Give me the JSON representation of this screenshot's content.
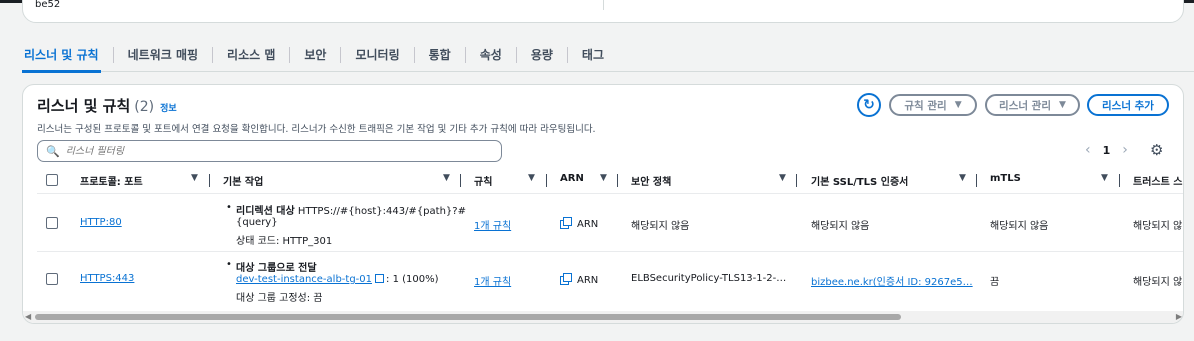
{
  "previous_card": {
    "text": "be52"
  },
  "tabs": [
    {
      "label": "리스너 및 규칙",
      "active": true
    },
    {
      "label": "네트워크 매핑"
    },
    {
      "label": "리소스 맵"
    },
    {
      "label": "보안"
    },
    {
      "label": "모니터링"
    },
    {
      "label": "통합"
    },
    {
      "label": "속성"
    },
    {
      "label": "용량"
    },
    {
      "label": "태그"
    }
  ],
  "panel": {
    "title": "리스너 및 규칙",
    "count": "(2)",
    "info": "정보",
    "description": "리스너는 구성된 프로토콜 및 포트에서 연결 요청을 확인합니다. 리스너가 수신한 트래픽은 기본 작업 및 기타 추가 규칙에 따라 라우팅됩니다.",
    "refresh_icon": "↻",
    "manage_rules_label": "규칙 관리",
    "manage_listeners_label": "리스너 관리",
    "add_listener_label": "리스너 추가",
    "caret": "▼",
    "search_placeholder": "리스너 필터링",
    "search_icon": "🔍",
    "pager": {
      "prev": "‹",
      "page": "1",
      "next": "›"
    },
    "settings_icon": "⚙"
  },
  "table": {
    "columns": {
      "protocol_port": "프로토콜: 포트",
      "default_action": "기본 작업",
      "rules": "규칙",
      "arn": "ARN",
      "security_policy": "보안 정책",
      "ssl_cert": "기본 SSL/TLS 인증서",
      "mtls": "mTLS",
      "trust_store": "트러스트 스"
    },
    "caret": "▼",
    "rows": [
      {
        "protocol_port": "HTTP:80",
        "action_title": "리디렉션 대상",
        "action_target": "HTTPS://#{host}:443/#{path}?#",
        "action_target_2": "{query}",
        "action_status": "상태 코드: HTTP_301",
        "rules": "1개 규칙",
        "arn": "ARN",
        "security_policy": "해당되지 않음",
        "ssl_cert": "해당되지 않음",
        "mtls": "해당되지 않음",
        "trust_store": "해당되지 않"
      },
      {
        "protocol_port": "HTTPS:443",
        "action_title": "대상 그룹으로 전달",
        "action_tg_link": "dev-test-instance-alb-tg-01",
        "action_tg_weight": ": 1 (100%)",
        "action_stickiness": "대상 그룹 고정성: 끔",
        "rules": "1개 규칙",
        "arn": "ARN",
        "security_policy": "ELBSecurityPolicy-TLS13-1-2-…",
        "ssl_cert": "bizbee.ne.kr(인증서 ID: 9267e5…",
        "mtls": "끔",
        "trust_store": "해당되지 않"
      }
    ]
  },
  "scrollbar": {
    "left_arrow": "◀",
    "right_arrow": "▶"
  }
}
